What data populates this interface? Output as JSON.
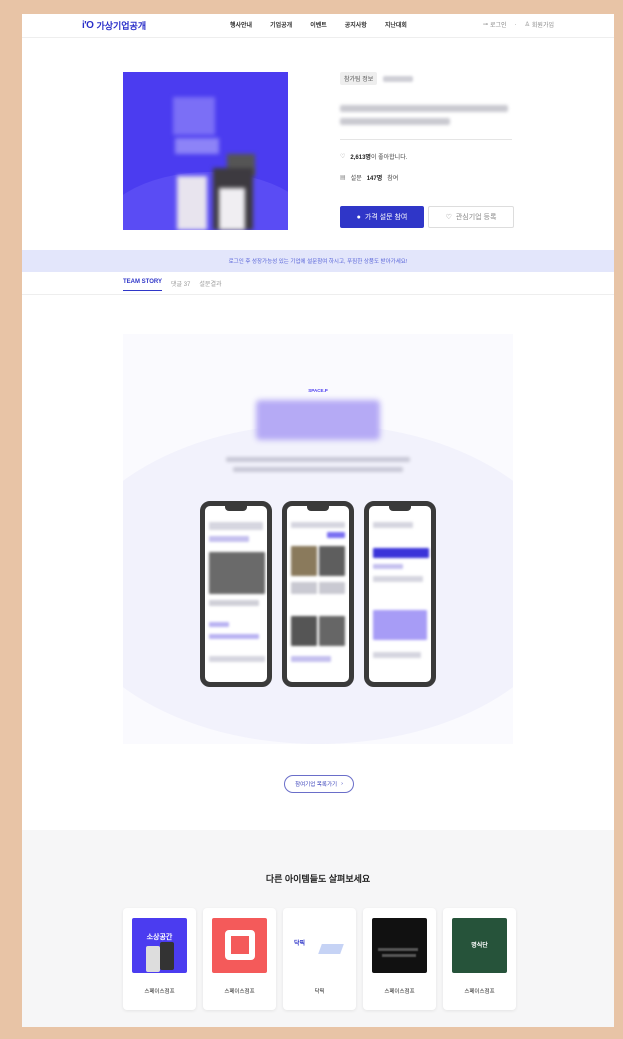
{
  "header": {
    "logo_mark": "i'O",
    "logo_text": "가상기업공개",
    "nav": [
      "행사안내",
      "기업공개",
      "이벤트",
      "공지사항",
      "지난대회"
    ],
    "login": "로그인",
    "signup": "회원가입"
  },
  "hero": {
    "tag": "참가팀 정보",
    "likes_count": "2,613명",
    "likes_suffix": "이 좋아합니다.",
    "survey_label": "설문",
    "survey_count": "147명",
    "survey_suffix": "참여",
    "primary_button": "가격 설문 참여",
    "secondary_button": "관심기업 등록"
  },
  "banner": {
    "text": "로그인 후 성장가능성 있는 기업에 설문참여 하시고, 푸짐한 상품도 받아가세요!"
  },
  "tabs": [
    {
      "label": "TEAM STORY"
    },
    {
      "label": "댓글 37"
    },
    {
      "label": "설문결과"
    }
  ],
  "story": {
    "label": "SPACE.P",
    "more_button": "참여기업 목록가기"
  },
  "other": {
    "title": "다른 아이템들도 살펴보세요",
    "items": [
      {
        "name": "스페이스점프",
        "thumb_text": "소상공간"
      },
      {
        "name": "스페이스점프"
      },
      {
        "name": "닥픽",
        "thumb_text": "닥픽"
      },
      {
        "name": "스페이스점프"
      },
      {
        "name": "스페이스점프",
        "thumb_text": "명식단"
      }
    ]
  },
  "colors": {
    "brand": "#2f36c8",
    "hero_bg": "#4b3cf0",
    "banner_bg": "#e3e6fb",
    "page_border": "#e8c4a6"
  }
}
